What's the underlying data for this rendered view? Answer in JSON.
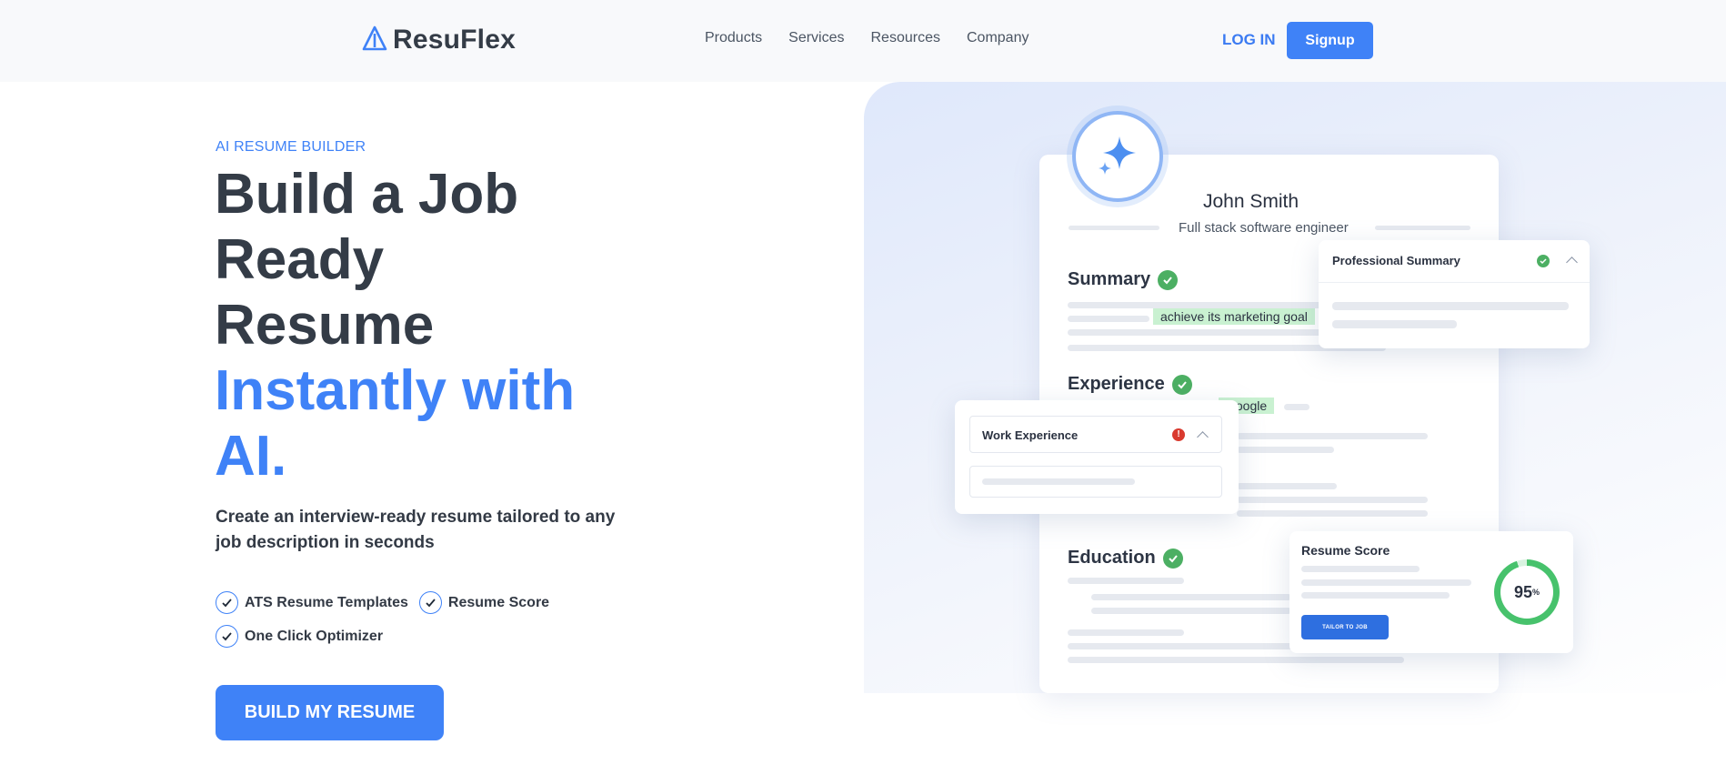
{
  "header": {
    "brand": "ResuFlex",
    "nav": [
      "Products",
      "Services",
      "Resources",
      "Company"
    ],
    "login": "LOG IN",
    "signup": "Signup"
  },
  "hero": {
    "eyebrow": "AI RESUME BUILDER",
    "headline_dark": [
      "Build a Job",
      "Ready",
      "Resume"
    ],
    "headline_blue": [
      "Instantly with",
      "AI."
    ],
    "subtext": "Create an interview-ready resume tailored to any job description in seconds",
    "features": [
      "ATS Resume Templates",
      "Resume Score",
      "One Click Optimizer"
    ],
    "cta": "BUILD MY RESUME"
  },
  "resume": {
    "name": "John Smith",
    "role": "Full stack software engineer",
    "sections": {
      "summary": "Summary",
      "experience": "Experience",
      "education": "Education"
    },
    "highlight_summary": "achieve its marketing goal",
    "highlight_experience": "Google"
  },
  "cards": {
    "professional_summary": "Professional Summary",
    "work_experience": "Work Experience",
    "resume_score": "Resume Score",
    "score_value": "95",
    "score_unit": "%",
    "tailor": "TAILOR TO JOB"
  },
  "colors": {
    "accent": "#3f82f7",
    "success": "#4caf63",
    "error": "#d93a2f"
  }
}
